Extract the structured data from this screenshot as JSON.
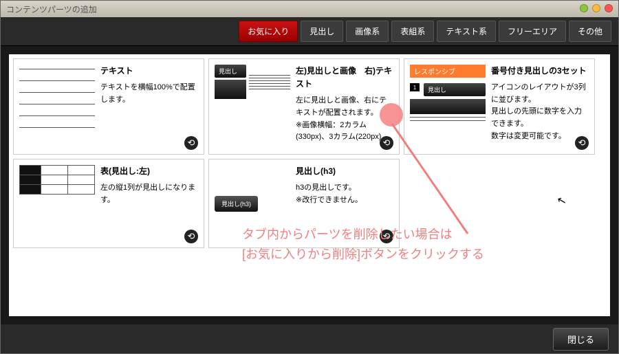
{
  "window_title": "コンテンツパーツの追加",
  "tabs": [
    {
      "label": "お気に入り",
      "active": true
    },
    {
      "label": "見出し",
      "active": false
    },
    {
      "label": "画像系",
      "active": false
    },
    {
      "label": "表組系",
      "active": false
    },
    {
      "label": "テキスト系",
      "active": false
    },
    {
      "label": "フリーエリア",
      "active": false
    },
    {
      "label": "その他",
      "active": false
    }
  ],
  "cards": [
    {
      "title": "テキスト",
      "desc": "テキストを横幅100%で配置します。"
    },
    {
      "title": "左)見出しと画像　右)テキスト",
      "desc": "左に見出しと画像、右にテキストが配置されます。\n※画像横幅：2カラム(330px)、3カラム(220px)",
      "thumb_label": "見出し"
    },
    {
      "responsive_badge": "レスポンシブ",
      "title": "番号付き見出しの3セット",
      "desc": "アイコンのレイアウトが3列に並びます。\n見出しの先頭に数字を入力できます。\n数字は変更可能です。",
      "thumb_num": "1",
      "thumb_label": "見出し"
    },
    {
      "title": "表(見出し:左)",
      "desc": "左の縦1列が見出しになります。"
    },
    {
      "title": "見出し(h3)",
      "desc": "h3の見出しです。\n※改行できません。",
      "thumb_label": "見出し(h3)"
    }
  ],
  "footer": {
    "close_label": "閉じる"
  },
  "annotation": {
    "line1": "タブ内からパーツを削除したい場合は",
    "line2": "[お気に入りから削除]ボタンをクリックする"
  }
}
